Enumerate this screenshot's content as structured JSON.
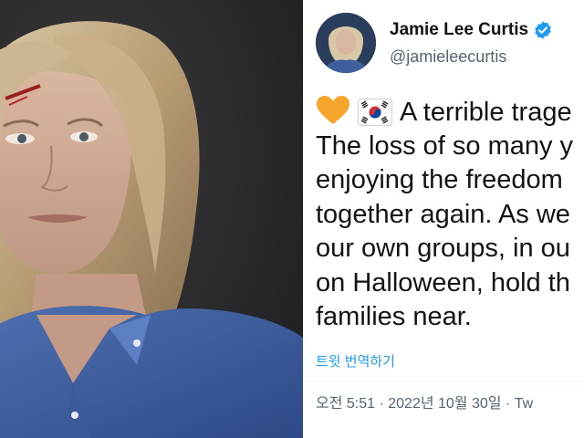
{
  "tweet": {
    "display_name": "Jamie Lee Curtis",
    "handle": "@jamieleecurtis",
    "verified_icon": "verified-badge-icon",
    "emojis": [
      "orange-heart-emoji",
      "south-korea-flag-emoji"
    ],
    "body_lines": [
      "A terrible trage",
      "The loss of so many y",
      "enjoying the freedom",
      "together again. As we",
      "our own groups, in ou",
      "on Halloween, hold th",
      "families near."
    ],
    "translate_label": "트윗 번역하기",
    "timestamp": "오전 5:51 · 2022년 10월 30일 · Tw"
  },
  "colors": {
    "link": "#1d9bf0",
    "secondary_text": "#536471",
    "primary_text": "#0f1419",
    "photo_background": "#2b2b2d"
  }
}
